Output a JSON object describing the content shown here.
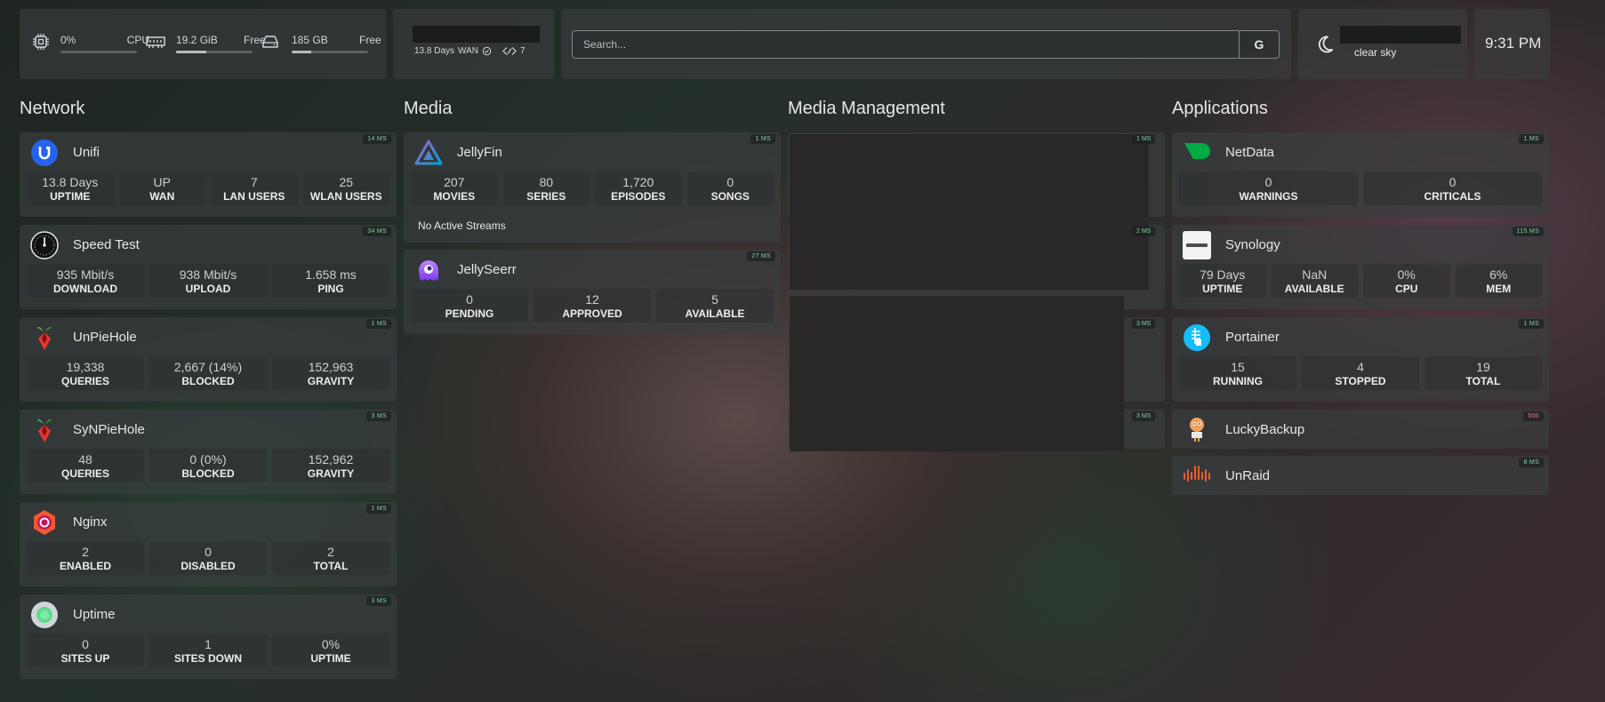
{
  "resources": {
    "cpu": {
      "value": "0%",
      "label": "CPU",
      "usage": 0
    },
    "memory": {
      "value": "19.2 GiB",
      "label": "Free",
      "usage": 40
    },
    "disk": {
      "value": "185 GB",
      "label": "Free",
      "usage": 25
    }
  },
  "unifi_widget": {
    "uptime": "13.8 Days",
    "wan": "WAN",
    "users": "7"
  },
  "search": {
    "placeholder": "Search...",
    "button": "G"
  },
  "weather": {
    "condition": "clear sky"
  },
  "clock": {
    "time": "9:31 PM"
  },
  "sections": {
    "network": "Network",
    "media": "Media",
    "media_management": "Media Management",
    "applications": "Applications"
  },
  "network": [
    {
      "name": "Unifi",
      "ms": "14 MS",
      "stats": [
        {
          "v": "13.8 Days",
          "l": "UPTIME"
        },
        {
          "v": "UP",
          "l": "WAN"
        },
        {
          "v": "7",
          "l": "LAN USERS"
        },
        {
          "v": "25",
          "l": "WLAN USERS"
        }
      ]
    },
    {
      "name": "Speed Test",
      "ms": "34 MS",
      "stats": [
        {
          "v": "935 Mbit/s",
          "l": "DOWNLOAD"
        },
        {
          "v": "938 Mbit/s",
          "l": "UPLOAD"
        },
        {
          "v": "1.658 ms",
          "l": "PING"
        }
      ]
    },
    {
      "name": "UnPieHole",
      "ms": "1 MS",
      "stats": [
        {
          "v": "19,338",
          "l": "QUERIES"
        },
        {
          "v": "2,667 (14%)",
          "l": "BLOCKED"
        },
        {
          "v": "152,963",
          "l": "GRAVITY"
        }
      ]
    },
    {
      "name": "SyNPieHole",
      "ms": "3 MS",
      "stats": [
        {
          "v": "48",
          "l": "QUERIES"
        },
        {
          "v": "0 (0%)",
          "l": "BLOCKED"
        },
        {
          "v": "152,962",
          "l": "GRAVITY"
        }
      ]
    },
    {
      "name": "Nginx",
      "ms": "1 MS",
      "stats": [
        {
          "v": "2",
          "l": "ENABLED"
        },
        {
          "v": "0",
          "l": "DISABLED"
        },
        {
          "v": "2",
          "l": "TOTAL"
        }
      ]
    },
    {
      "name": "Uptime",
      "ms": "3 MS",
      "stats": [
        {
          "v": "0",
          "l": "SITES UP"
        },
        {
          "v": "1",
          "l": "SITES DOWN"
        },
        {
          "v": "0%",
          "l": "UPTIME"
        }
      ]
    }
  ],
  "media": [
    {
      "name": "JellyFin",
      "ms": "1 MS",
      "stats": [
        {
          "v": "207",
          "l": "MOVIES"
        },
        {
          "v": "80",
          "l": "SERIES"
        },
        {
          "v": "1,720",
          "l": "EPISODES"
        },
        {
          "v": "0",
          "l": "SONGS"
        }
      ],
      "note": "No Active Streams"
    },
    {
      "name": "JellySeerr",
      "ms": "27 MS",
      "stats": [
        {
          "v": "0",
          "l": "PENDING"
        },
        {
          "v": "12",
          "l": "APPROVED"
        },
        {
          "v": "5",
          "l": "AVAILABLE"
        }
      ]
    }
  ],
  "media_management": {
    "ms": [
      "1 MS",
      "2 MS",
      "3 MS",
      "3 MS"
    ]
  },
  "applications": [
    {
      "name": "NetData",
      "ms": "1 MS",
      "stats": [
        {
          "v": "0",
          "l": "WARNINGS"
        },
        {
          "v": "0",
          "l": "CRITICALS"
        }
      ]
    },
    {
      "name": "Synology",
      "ms": "115 MS",
      "stats": [
        {
          "v": "79 Days",
          "l": "UPTIME"
        },
        {
          "v": "NaN",
          "l": "AVAILABLE"
        },
        {
          "v": "0%",
          "l": "CPU"
        },
        {
          "v": "6%",
          "l": "MEM"
        }
      ]
    },
    {
      "name": "Portainer",
      "ms": "1 MS",
      "stats": [
        {
          "v": "15",
          "l": "RUNNING"
        },
        {
          "v": "4",
          "l": "STOPPED"
        },
        {
          "v": "19",
          "l": "TOTAL"
        }
      ]
    },
    {
      "name": "LuckyBackup",
      "ms": "500",
      "ms_status": "error"
    },
    {
      "name": "UnRaid",
      "ms": "8 MS"
    }
  ],
  "colors": {
    "ms_ok": "#7fd4a0",
    "ms_error": "#f47a8a",
    "unifi_blue": "#2563eb",
    "netdata_green": "#00ab44",
    "portainer_blue": "#13bef9",
    "unraid_orange": "#f15a2c"
  }
}
